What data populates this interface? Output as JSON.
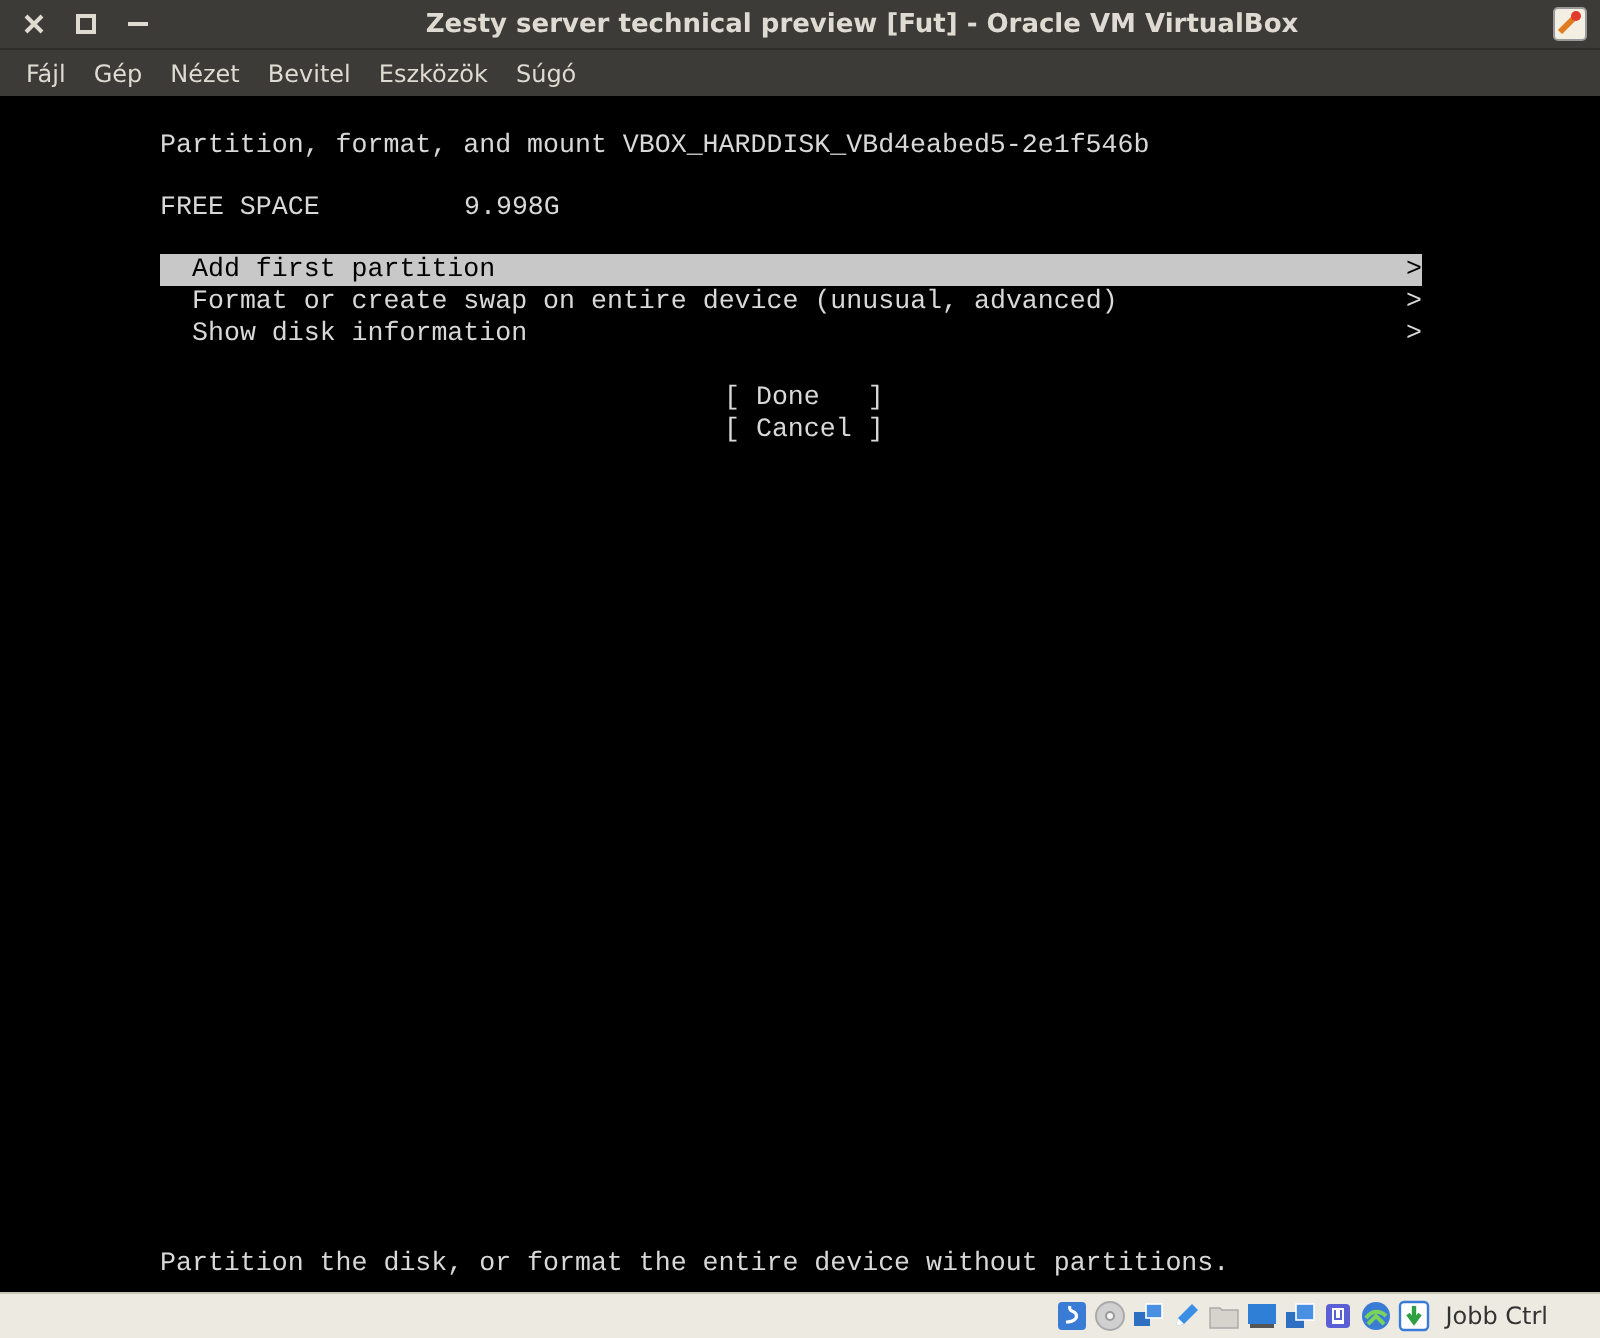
{
  "window": {
    "title": "Zesty server technical preview [Fut] - Oracle VM VirtualBox"
  },
  "menu": [
    "Fájl",
    "Gép",
    "Nézet",
    "Bevitel",
    "Eszközök",
    "Súgó"
  ],
  "console": {
    "heading": "Partition, format, and mount VBOX_HARDDISK_VBd4eabed5-2e1f546b",
    "free_space": {
      "label": "FREE SPACE",
      "value": "9.998G"
    },
    "options": [
      {
        "label": "Add first partition",
        "arrow": ">",
        "selected": true
      },
      {
        "label": "Format or create swap on entire device (unusual, advanced)",
        "arrow": ">",
        "selected": false
      },
      {
        "label": "Show disk information",
        "arrow": ">",
        "selected": false
      }
    ],
    "buttons": [
      "[ Done   ]",
      "[ Cancel ]"
    ],
    "help": "Partition the disk, or format the entire device without partitions."
  },
  "status_bar": {
    "host_key": "Jobb Ctrl"
  }
}
